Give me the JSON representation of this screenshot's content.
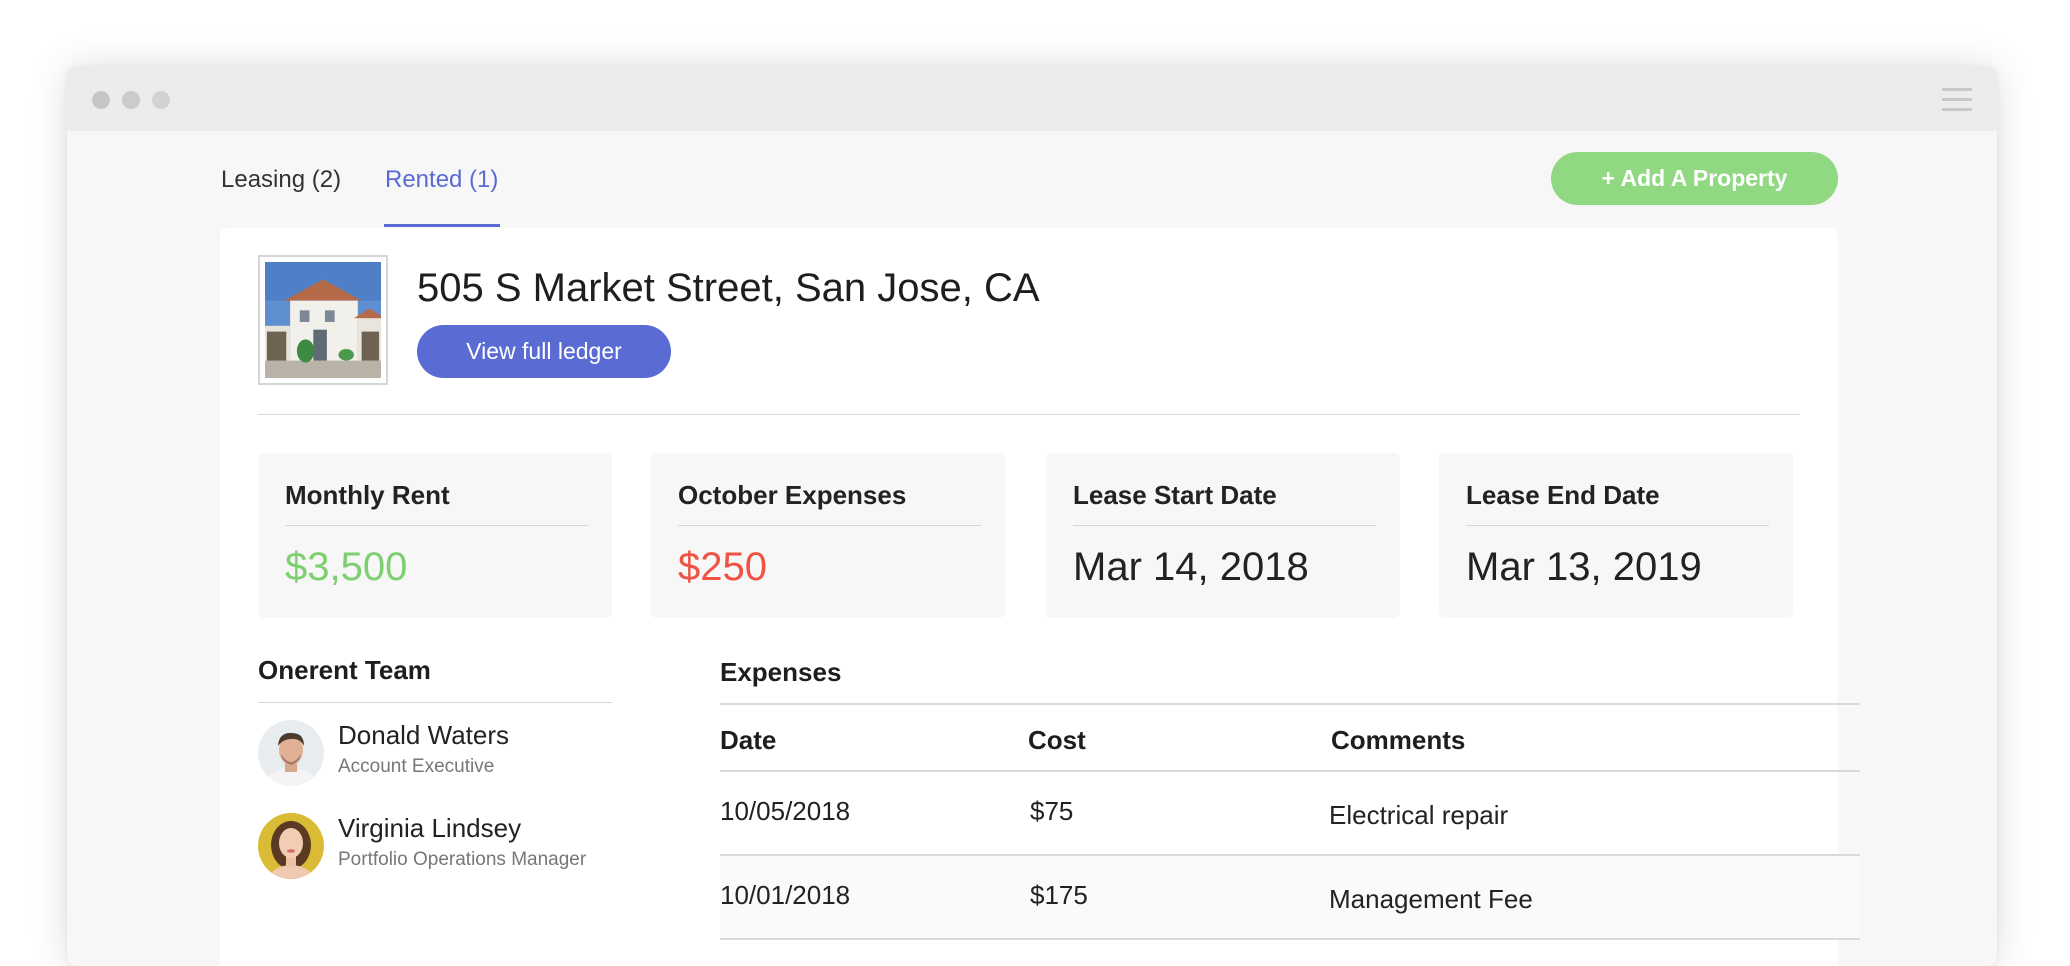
{
  "tabs": [
    {
      "label": "Leasing (2)"
    },
    {
      "label": "Rented (1)"
    }
  ],
  "add_property_label": "+ Add A Property",
  "property": {
    "address": "505 S Market Street, San Jose, CA",
    "ledger_button_label": "View full ledger"
  },
  "stats": [
    {
      "label": "Monthly Rent",
      "value": "$3,500",
      "color": "#7dcf6f"
    },
    {
      "label": "October Expenses",
      "value": "$250",
      "color": "#ef5344"
    },
    {
      "label": "Lease Start Date",
      "value": "Mar 14, 2018"
    },
    {
      "label": "Lease End Date",
      "value": "Mar 13, 2019"
    }
  ],
  "team": {
    "title": "Onerent Team",
    "members": [
      {
        "name": "Donald Waters",
        "role": "Account Executive"
      },
      {
        "name": "Virginia Lindsey",
        "role": "Portfolio Operations Manager"
      }
    ]
  },
  "expenses": {
    "title": "Expenses",
    "columns": [
      "Date",
      "Cost",
      "Comments"
    ],
    "rows": [
      {
        "date": "10/05/2018",
        "cost": "$75",
        "comment": "Electrical repair"
      },
      {
        "date": "10/01/2018",
        "cost": "$175",
        "comment": "Management Fee"
      }
    ]
  },
  "colors": {
    "accent": "#5a6bd3",
    "add_button": "#91d883",
    "positive": "#7dcf6f",
    "negative": "#ef5344"
  },
  "icons": {
    "menu": "hamburger-menu-icon",
    "window_controls": "window-dot-icon"
  }
}
